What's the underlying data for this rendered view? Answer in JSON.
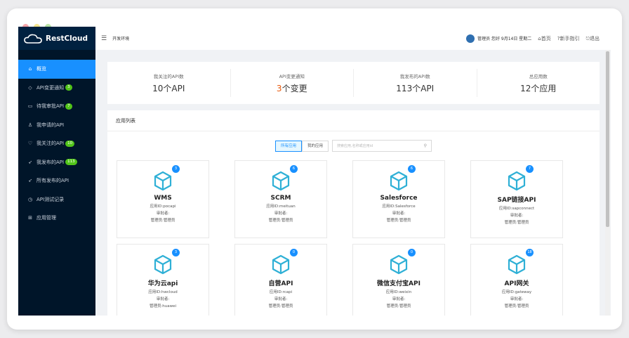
{
  "brand": {
    "name": "RestCloud"
  },
  "colors": {
    "sidebar": "#001529",
    "accent": "#1890ff",
    "badge": "#52c41a",
    "dot_red": "#f6a5a9",
    "dot_yellow": "#f6e58d",
    "dot_green": "#b8e3a4"
  },
  "sidebar": {
    "items": [
      {
        "label": "概览",
        "icon": "home-icon",
        "active": true
      },
      {
        "label": "API变更通知",
        "icon": "tag-icon",
        "badge": "3"
      },
      {
        "label": "待我审批API",
        "icon": "card-icon",
        "badge": "7"
      },
      {
        "label": "我申请的API",
        "icon": "user-icon"
      },
      {
        "label": "我关注的API",
        "icon": "heart-icon",
        "badge": "10"
      },
      {
        "label": "我发布的API",
        "icon": "rocket-icon",
        "badge": "113"
      },
      {
        "label": "所有发布的API",
        "icon": "rocket-icon"
      },
      {
        "label": "API测试记录",
        "icon": "clock-icon"
      },
      {
        "label": "应用管理",
        "icon": "grid-icon"
      }
    ]
  },
  "header": {
    "env": "开发环境",
    "greeting": "管理员 您好 9月14日 星期二",
    "home": "首页",
    "guide": "新手指引",
    "logout": "退出"
  },
  "stats": [
    {
      "label": "我关注的API数",
      "num": "10",
      "unit": "个API"
    },
    {
      "label": "API变更通知",
      "num": "3",
      "unit": "个变更"
    },
    {
      "label": "我发布的API数",
      "num": "113",
      "unit": "个API"
    },
    {
      "label": "总应用数",
      "num": "12",
      "unit": "个应用"
    }
  ],
  "apps_panel": {
    "title": "应用列表",
    "filter_all": "所有应用",
    "filter_mine": "我的应用",
    "search_placeholder": "搜索应用,名称或应用id"
  },
  "apps": [
    {
      "name": "WMS",
      "count": "3",
      "id_line": "应用ID:pocapi",
      "approver": "审批者:",
      "admin": "管理员:管理员"
    },
    {
      "name": "SCRM",
      "count": "6",
      "id_line": "应用ID:meituan",
      "approver": "审批者:",
      "admin": "管理员:管理员"
    },
    {
      "name": "Salesforce",
      "count": "6",
      "id_line": "应用ID:Salesforce",
      "approver": "审批者:",
      "admin": "管理员:管理员"
    },
    {
      "name": "SAP链接API",
      "count": "7",
      "id_line": "应用ID:sapconnect",
      "approver": "审批者:",
      "admin": "管理员:管理员"
    },
    {
      "name": "华为云api",
      "count": "3",
      "id_line": "应用ID:hwcloud",
      "approver": "审批者:",
      "admin": "管理员:huawei"
    },
    {
      "name": "自营API",
      "count": "0",
      "id_line": "应用ID:rcapi",
      "approver": "审批者:",
      "admin": "管理员:管理员"
    },
    {
      "name": "微信支付宝API",
      "count": "0",
      "id_line": "应用ID:weixin",
      "approver": "审批者:",
      "admin": "管理员:管理员"
    },
    {
      "name": "API网关",
      "count": "18",
      "id_line": "应用ID:gateway",
      "approver": "审批者:",
      "admin": "管理员:管理员"
    }
  ]
}
